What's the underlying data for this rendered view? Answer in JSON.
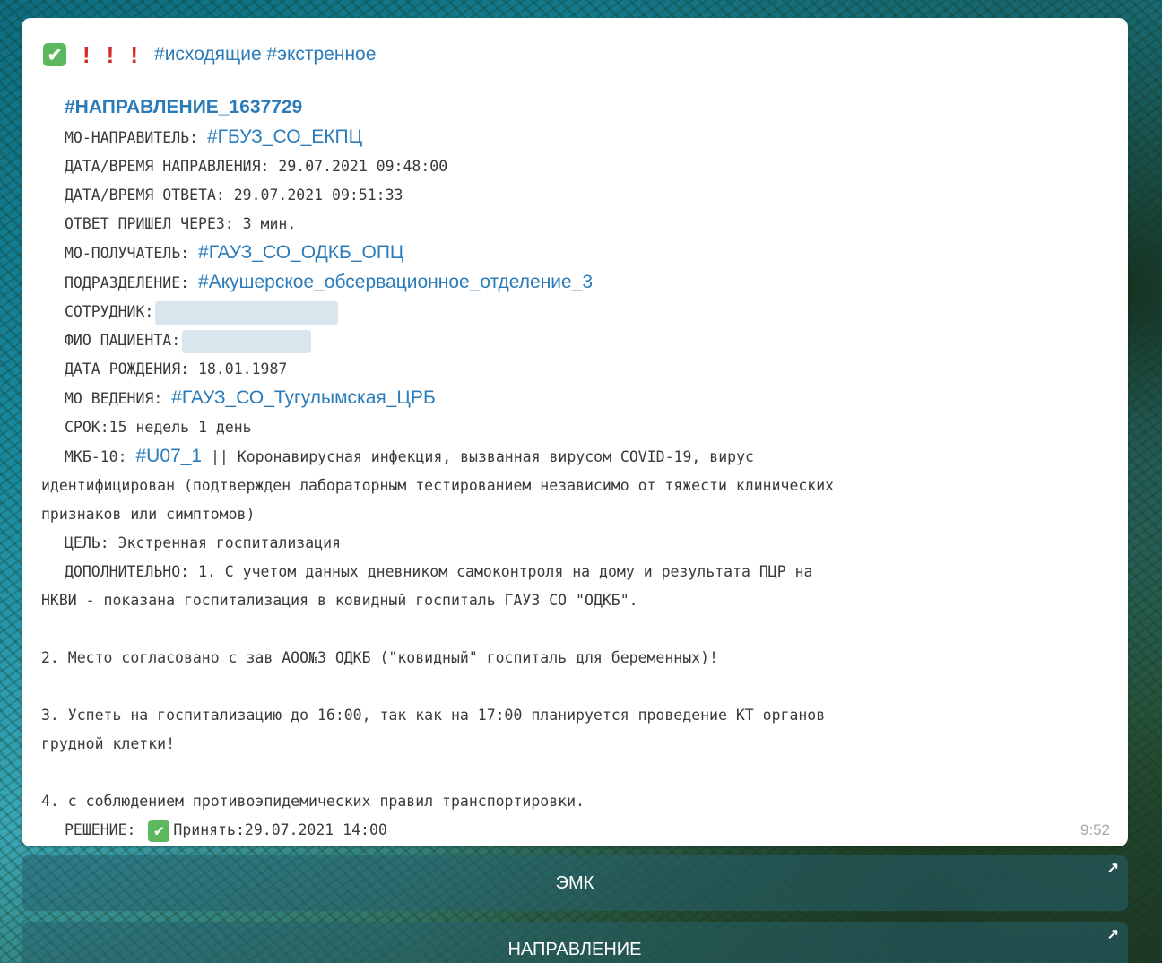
{
  "header": {
    "check_emoji": "✔",
    "exclamations": [
      "!",
      "!",
      "!"
    ],
    "tags": "#исходящие #экстренное"
  },
  "message": {
    "direction_tag": "#НАПРАВЛЕНИЕ_1637729",
    "sender_label": "МО-НАПРАВИТЕЛЬ:",
    "sender_tag": "#ГБУЗ_СО_ЕКПЦ",
    "direction_datetime": "ДАТА/ВРЕМЯ НАПРАВЛЕНИЯ: 29.07.2021 09:48:00",
    "answer_datetime": "ДАТА/ВРЕМЯ ОТВЕТА: 29.07.2021 09:51:33",
    "answer_after": "ОТВЕТ ПРИШЕЛ ЧЕРЕЗ: 3 мин.",
    "receiver_label": "МО-ПОЛУЧАТЕЛЬ:",
    "receiver_tag": "#ГАУЗ_СО_ОДКБ_ОПЦ",
    "department_label": "ПОДРАЗДЕЛЕНИЕ:",
    "department_tag": "#Акушерское_обсервационное_отделение_3",
    "employee_label": "СОТРУДНИК:",
    "patient_label": "ФИО ПАЦИЕНТА:",
    "birth_date": "ДАТА РОЖДЕНИЯ: 18.01.1987",
    "mo_label": "МО ВЕДЕНИЯ:",
    "mo_tag": "#ГАУЗ_СО_Тугулымская_ЦРБ",
    "term": "СРОК:15 недель 1 день",
    "icd_label": "МКБ-10:",
    "icd_tag": "#U07_1",
    "icd_text_1": " || Коронавирусная инфекция, вызванная вирусом COVID-19, вирус",
    "icd_text_2": "идентифицирован (подтвержден лабораторным тестированием независимо от тяжести клинических",
    "icd_text_3": "признаков или симптомов)",
    "goal": "ЦЕЛЬ: Экстренная госпитализация",
    "extra_1": "ДОПОЛНИТЕЛЬНО: 1. С учетом данных дневником самоконтроля на дому и результата ПЦР на",
    "extra_2": "НКВИ - показана госпитализация в ковидный госпиталь ГАУЗ СО \"ОДКБ\".",
    "point_2": "2. Место согласовано с зав АОО№3 ОДКБ (\"ковидный\" госпиталь для беременных)!",
    "point_3a": "3. Успеть на госпитализацию до 16:00, так как на 17:00 планируется проведение КТ органов",
    "point_3b": "грудной клетки!",
    "point_4": "4. с соблюдением противоэпидемических правил транспортировки.",
    "decision_label": "РЕШЕНИЕ:",
    "decision_check": "✔",
    "decision_text": "Принять:29.07.2021 14:00",
    "time": "9:52"
  },
  "buttons": {
    "emk_label": "ЭМК",
    "direction_label": "НАПРАВЛЕНИЕ",
    "arrow": "↗"
  },
  "colors": {
    "link": "#2b7bb9",
    "check_green": "#5cb85c",
    "alert_red": "#d62c2c",
    "text": "#3a3a3a"
  }
}
